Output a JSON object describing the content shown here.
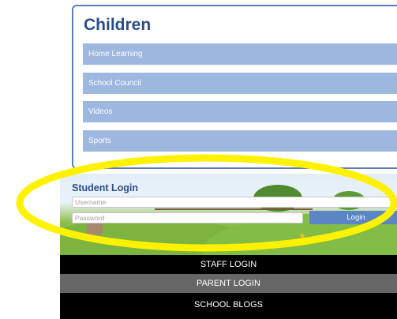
{
  "children_panel": {
    "title": "Children",
    "items": [
      {
        "label": "Home Learning"
      },
      {
        "label": "School Council"
      },
      {
        "label": "Videos"
      },
      {
        "label": "Sports"
      }
    ]
  },
  "student_login": {
    "title": "Student Login",
    "username_placeholder": "Username",
    "password_placeholder": "Password",
    "login_label": "Login"
  },
  "bottom_links": {
    "staff_login": "STAFF LOGIN",
    "parent_login": "PARENT LOGIN",
    "school_blogs": "SCHOOL BLOGS"
  },
  "colors": {
    "accent": "#2b4d86",
    "menu_item": "#9db7df",
    "button": "#5b85c5",
    "highlight_ring": "#fff200"
  }
}
